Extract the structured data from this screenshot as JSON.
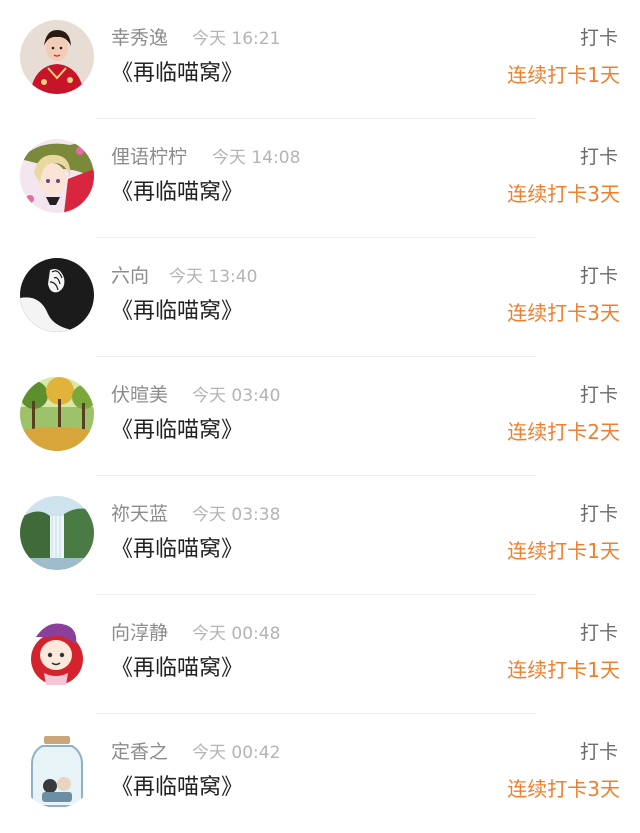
{
  "entries": [
    {
      "name": "幸秀逸",
      "time": "今天 16:21",
      "book": "《再临喵窝》",
      "action": "打卡",
      "streak": "连续打卡1天",
      "avatar": "avatar-woman-red-dress"
    },
    {
      "name": "俚语柠柠",
      "time": "今天 14:08",
      "book": "《再临喵窝》",
      "action": "打卡",
      "streak": "连续打卡3天",
      "avatar": "avatar-anime-girl"
    },
    {
      "name": "六向",
      "time": "今天 13:40",
      "book": "《再临喵窝》",
      "action": "打卡",
      "streak": "连续打卡3天",
      "avatar": "avatar-hand-sketch"
    },
    {
      "name": "伏暄美",
      "time": "今天 03:40",
      "book": "《再临喵窝》",
      "action": "打卡",
      "streak": "连续打卡2天",
      "avatar": "avatar-autumn-park"
    },
    {
      "name": "祢天蓝",
      "time": "今天 03:38",
      "book": "《再临喵窝》",
      "action": "打卡",
      "streak": "连续打卡1天",
      "avatar": "avatar-waterfall"
    },
    {
      "name": "向淳静",
      "time": "今天 00:48",
      "book": "《再临喵窝》",
      "action": "打卡",
      "streak": "连续打卡1天",
      "avatar": "avatar-cartoon-chibi"
    },
    {
      "name": "定香之",
      "time": "今天 00:42",
      "book": "《再临喵窝》",
      "action": "打卡",
      "streak": "连续打卡3天",
      "avatar": "avatar-jar-illustration"
    }
  ],
  "colors": {
    "streak": "#f07e2c",
    "name": "#8c8c8c",
    "time": "#b4b4b4",
    "book": "#222222",
    "action": "#6b6b6b"
  }
}
